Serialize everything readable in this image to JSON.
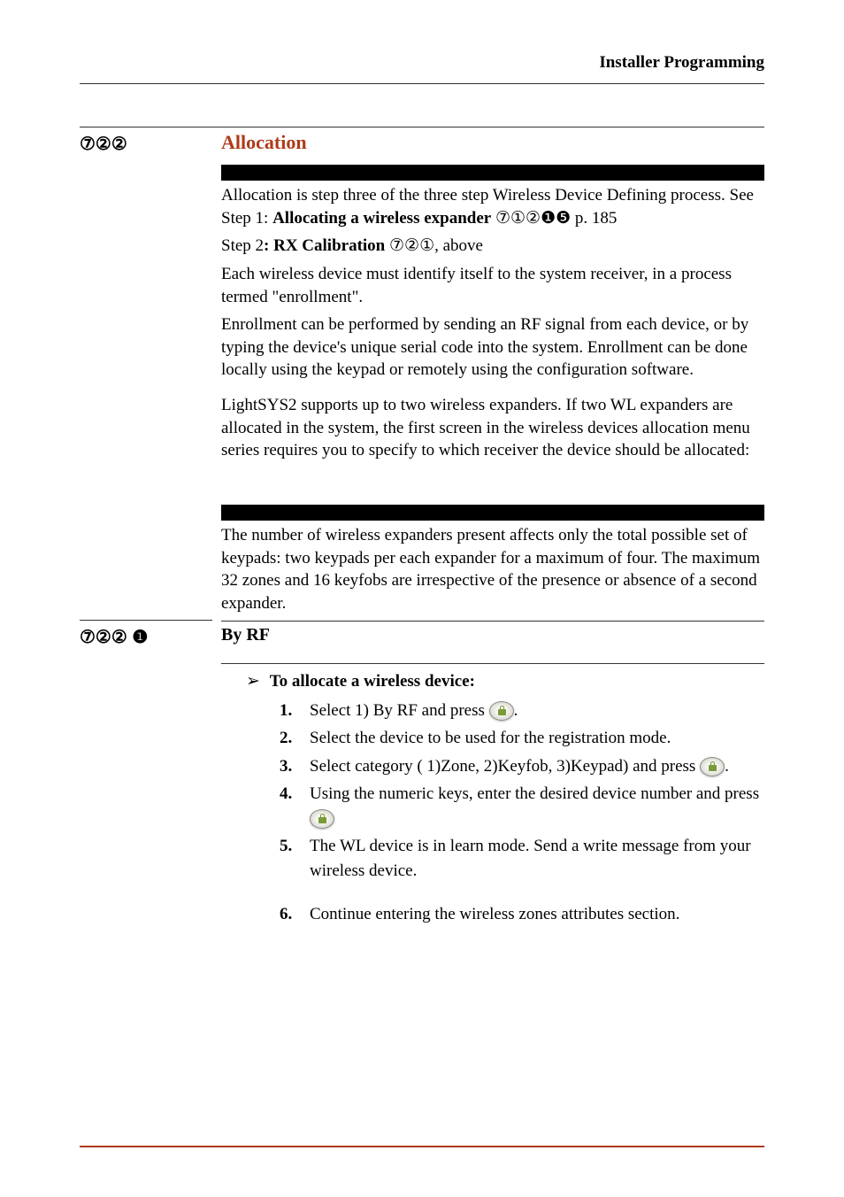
{
  "header": {
    "title": "Installer Programming"
  },
  "sections": {
    "allocation": {
      "left_marker": "⑦②②",
      "heading": "Allocation",
      "para1_a": "Allocation is step three of the three step Wireless Device Defining process. See Step 1: ",
      "para1_b": "Allocating a wireless expander",
      "para1_c": " ⑦①②❶❺  p. 185",
      "para2_a": "Step 2",
      "para2_b": ": RX Calibration",
      "para2_c": " ⑦②①, above",
      "para3": "Each wireless device must identify itself to the system receiver, in a process termed \"enrollment\".",
      "para4": "Enrollment can be performed by sending an RF signal from each device, or by typing the device's unique serial code into the system. Enrollment can be done locally using the keypad or remotely using the configuration software.",
      "para5": "LightSYS2 supports up to two wireless expanders. If two WL expanders are allocated in the system, the first screen in the wireless devices allocation menu series requires you to specify to which receiver the device should be allocated:",
      "note": "The number of wireless expanders present affects only the total possible set of keypads: two keypads per each expander for a maximum of four. The maximum 32 zones and 16 keyfobs are irrespective of the presence or absence of a second expander."
    },
    "byrf": {
      "left_marker": "⑦②② ❶",
      "heading": "By RF",
      "intro": "To allocate a wireless device:",
      "steps": [
        "Select 1) By RF and press ",
        "Select the device to be used for the registration mode.",
        "Select category ( 1)Zone, 2)Keyfob, 3)Keypad) and press ",
        "Using the numeric keys, enter the desired device number and press ",
        "The WL device is in learn mode. Send a write message from your wireless device.",
        "Continue entering the wireless zones attributes section."
      ],
      "step_numbers": [
        "1.",
        "2.",
        "3.",
        "4.",
        "5.",
        "6."
      ]
    }
  }
}
